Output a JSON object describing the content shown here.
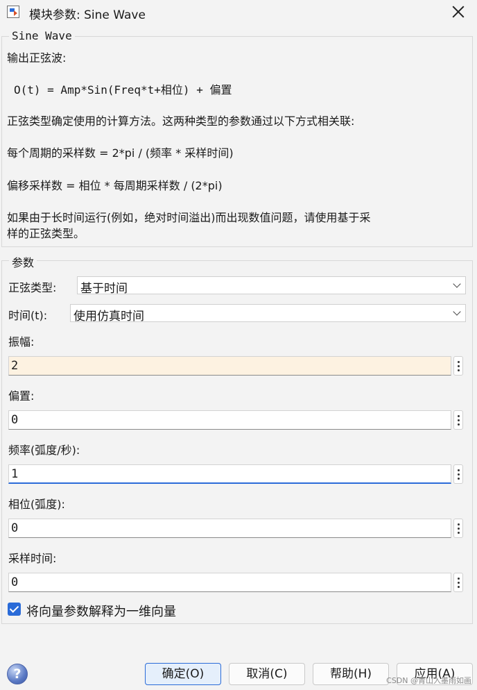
{
  "window": {
    "title": "模块参数: Sine Wave",
    "icon": "simulink-block-icon"
  },
  "description": {
    "group_title": "Sine Wave",
    "line1": "输出正弦波:",
    "formula": "O(t) = Amp*Sin(Freq*t+相位) + 偏置",
    "line3": "正弦类型确定使用的计算方法。这两种类型的参数通过以下方式相关联:",
    "line4": "每个周期的采样数 = 2*pi / (频率 * 采样时间)",
    "line5": "偏移采样数 = 相位 * 每周期采样数 / (2*pi)",
    "line6a": "如果由于长时间运行(例如，绝对时间溢出)而出现数值问题，请使用基于采",
    "line6b": "样的正弦类型。"
  },
  "params": {
    "group_title": "参数",
    "sine_type_label": "正弦类型:",
    "sine_type_value": "基于时间",
    "time_label": "时间(t):",
    "time_value": "使用仿真时间",
    "amplitude_label": "振幅:",
    "amplitude_value": "2",
    "bias_label": "偏置:",
    "bias_value": "0",
    "frequency_label": "频率(弧度/秒):",
    "frequency_value": "1",
    "phase_label": "相位(弧度):",
    "phase_value": "0",
    "sample_time_label": "采样时间:",
    "sample_time_value": "0",
    "interpret_vector_label": "将向量参数解释为一维向量",
    "interpret_vector_checked": true
  },
  "buttons": {
    "ok": "确定(O)",
    "cancel": "取消(C)",
    "help": "帮助(H)",
    "apply": "应用(A)",
    "help_icon": "?"
  },
  "watermark": "CSDN @青山入墨雨如画",
  "colors": {
    "accent": "#2a6bd8",
    "highlight_field": "#fdf2e1",
    "background": "#f3f3f3"
  }
}
